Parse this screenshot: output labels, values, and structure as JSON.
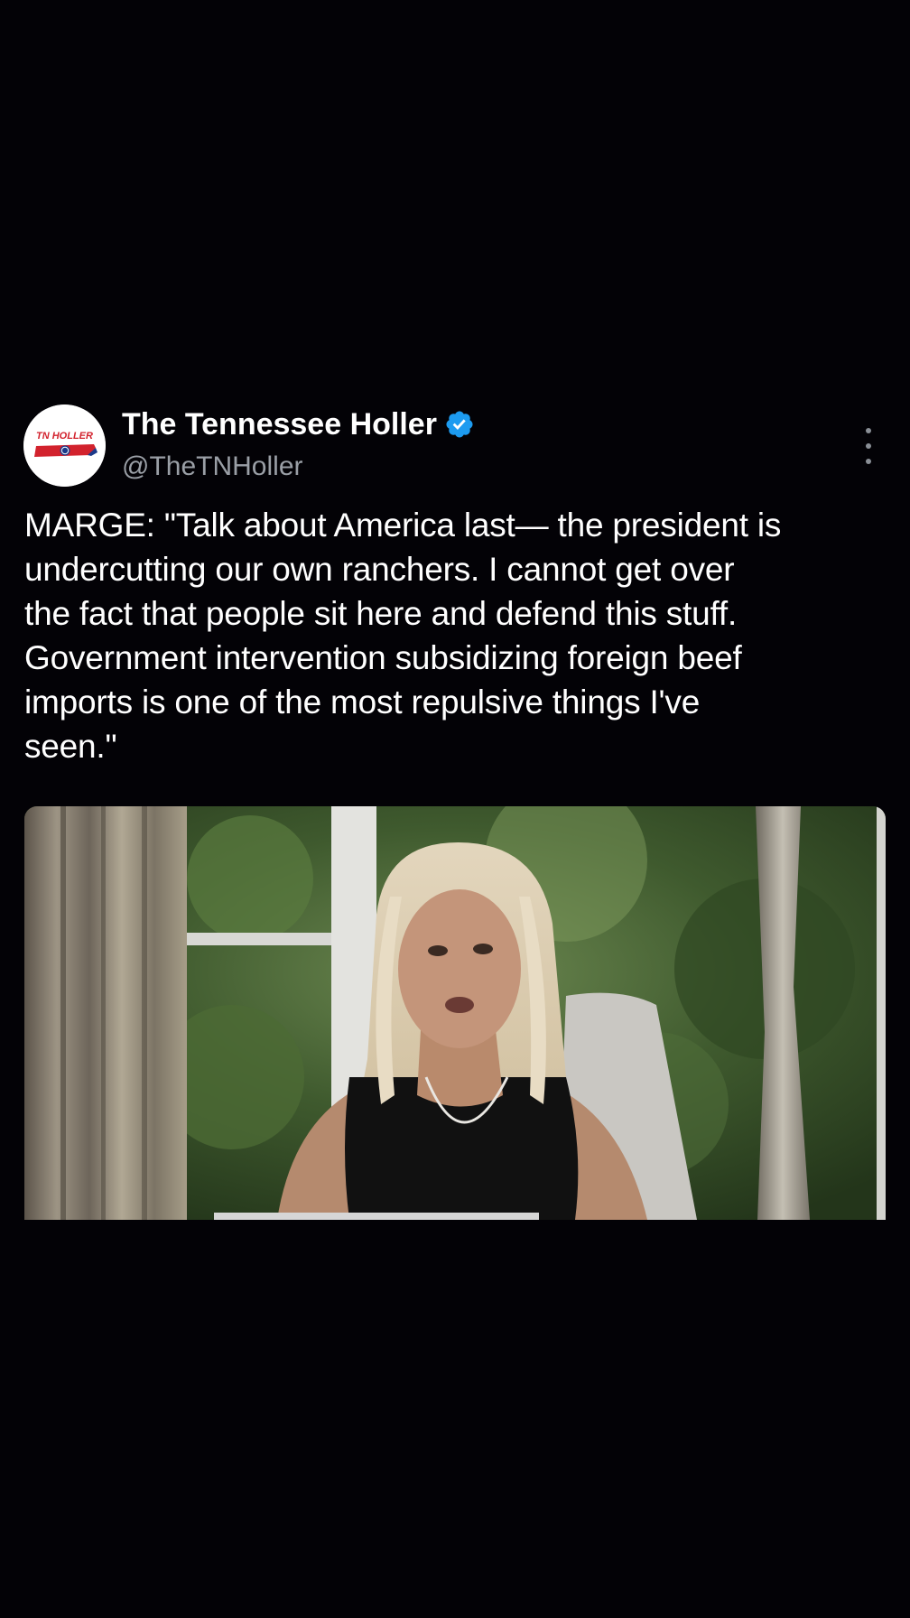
{
  "tweet": {
    "display_name": "The Tennessee Holler",
    "handle": "@TheTNHoller",
    "avatar_text": "TN HOLLER",
    "text": "MARGE: \"Talk about America last— the president is\nundercutting our own ranchers. I cannot get over\nthe fact that people sit here and defend this stuff.\nGovernment intervention subsidizing foreign beef\nimports is one of the most repulsive things I've\nseen.\""
  },
  "colors": {
    "background": "#030206",
    "verified": "#1d9bf0",
    "handle": "#9a9fa6",
    "avatar_red": "#d2222d"
  },
  "icons": {
    "verified": "verified-badge-icon",
    "more": "more-vertical-icon"
  }
}
